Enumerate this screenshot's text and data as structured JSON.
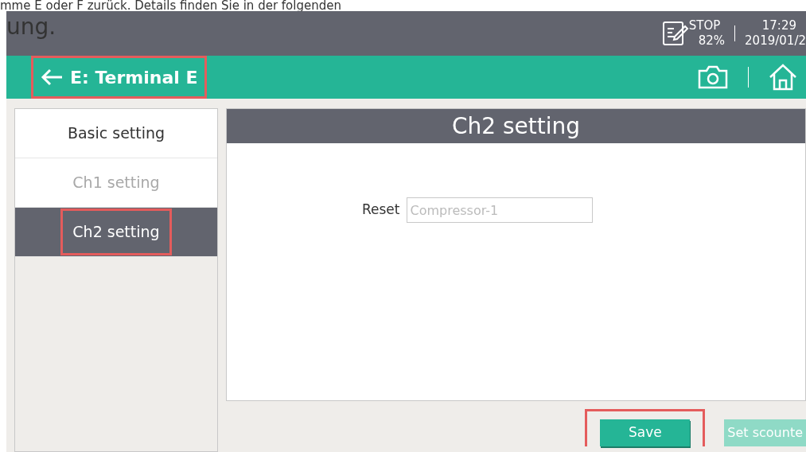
{
  "document_text": [
    "mme E oder F zurück. Details finden Sie in der folgenden",
    "ung."
  ],
  "status_bar": {
    "mode": "STOP",
    "battery": "82%",
    "time": "17:29",
    "date": "2019/01/2"
  },
  "header": {
    "title": "E: Terminal E",
    "highlighted": true
  },
  "sidebar": {
    "items": [
      {
        "label": "Basic setting",
        "selected": false,
        "disabled": false,
        "highlighted": false
      },
      {
        "label": "Ch1 setting",
        "selected": false,
        "disabled": true,
        "highlighted": false
      },
      {
        "label": "Ch2 setting",
        "selected": true,
        "disabled": false,
        "highlighted": true
      }
    ]
  },
  "panel": {
    "title": "Ch2 setting",
    "field": {
      "label": "Reset",
      "placeholder": "Compressor-1"
    }
  },
  "buttons": [
    {
      "label": "Save",
      "disabled": false,
      "highlighted": true
    },
    {
      "label": "Set scounte",
      "disabled": true,
      "highlighted": false
    }
  ]
}
